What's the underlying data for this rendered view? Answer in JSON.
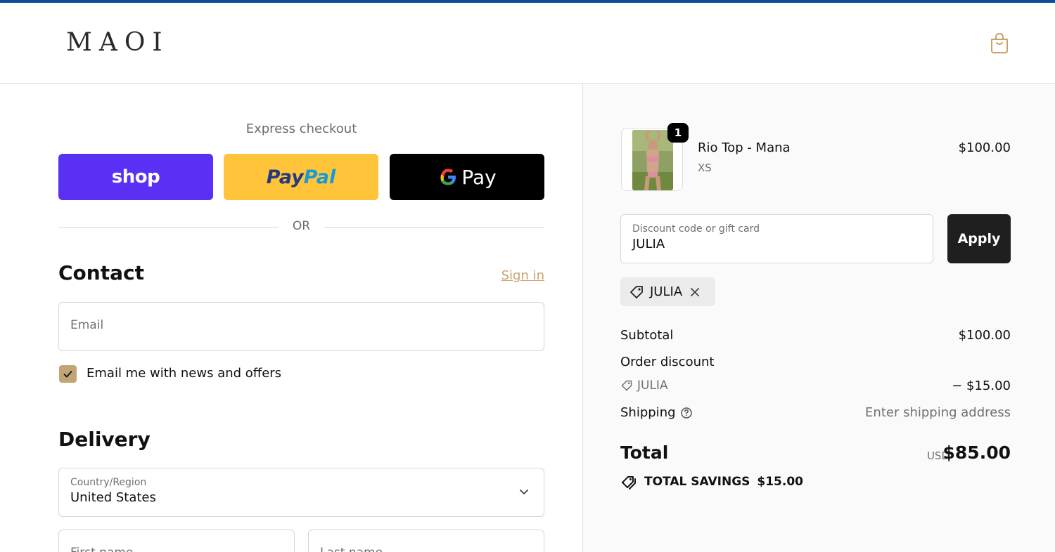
{
  "header": {
    "logo": "MAOI",
    "cart_icon": "shopping-bag-icon"
  },
  "express": {
    "label": "Express checkout",
    "shop_label": "shop",
    "paypal_label_1": "Pay",
    "paypal_label_2": "Pal",
    "gpay_label": "Pay",
    "or_text": "OR"
  },
  "contact": {
    "title": "Contact",
    "signin": "Sign in",
    "email_placeholder": "Email",
    "newsletter_label": "Email me with news and offers",
    "newsletter_checked": true
  },
  "delivery": {
    "title": "Delivery",
    "country_label": "Country/Region",
    "country_value": "United States",
    "first_name_placeholder": "First name",
    "last_name_placeholder": "Last name"
  },
  "order": {
    "item": {
      "name": "Rio Top - Mana",
      "variant": "XS",
      "price": "$100.00",
      "quantity": "1"
    },
    "discount": {
      "label": "Discount code or gift card",
      "value": "JULIA",
      "apply_label": "Apply",
      "applied_code": "JULIA"
    },
    "summary": {
      "subtotal_label": "Subtotal",
      "subtotal_value": "$100.00",
      "order_discount_label": "Order discount",
      "discount_code": "JULIA",
      "discount_value": "− $15.00",
      "shipping_label": "Shipping",
      "shipping_value": "Enter shipping address",
      "total_label": "Total",
      "currency": "USD",
      "total_value": "$85.00",
      "savings_label": "TOTAL SAVINGS",
      "savings_value": "$15.00"
    }
  },
  "colors": {
    "accent_gold": "#c9a26b",
    "shop_purple": "#5a31f4",
    "paypal_yellow": "#ffc439",
    "top_bar_blue": "#0f4c97"
  }
}
